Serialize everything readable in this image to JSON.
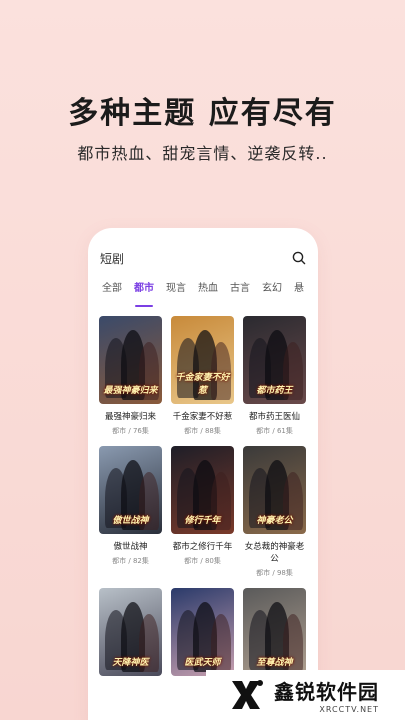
{
  "promo": {
    "title": "多种主题 应有尽有",
    "subtitle": "都市热血、甜宠言情、逆袭反转.."
  },
  "app": {
    "search_text": "短剧",
    "search_icon": "search-icon",
    "accent": "#7b3fe4",
    "tabs": [
      "全部",
      "都市",
      "现言",
      "热血",
      "古言",
      "玄幻",
      "悬"
    ],
    "active_tab": 1,
    "cards": [
      {
        "title": "最强神豪归来",
        "meta": "都市 / 76集",
        "caption": "最强神豪归来",
        "bg1": "#3a4a6a",
        "bg2": "#8a5a3a"
      },
      {
        "title": "千金家妻不好惹",
        "meta": "都市 / 88集",
        "caption": "千金家妻不好惹",
        "bg1": "#c88a3a",
        "bg2": "#e9c78a"
      },
      {
        "title": "都市药王医仙",
        "meta": "都市 / 61集",
        "caption": "都市药王",
        "bg1": "#2a2a30",
        "bg2": "#6a4a4a"
      },
      {
        "title": "傲世战神",
        "meta": "都市 / 82集",
        "caption": "傲世战神",
        "bg1": "#8a9ab0",
        "bg2": "#2a2f3a"
      },
      {
        "title": "都市之修行千年",
        "meta": "都市 / 80集",
        "caption": "修行千年",
        "bg1": "#1e1e28",
        "bg2": "#7a3a2a"
      },
      {
        "title": "女总裁的神豪老公",
        "meta": "都市 / 98集",
        "caption": "神豪老公",
        "bg1": "#3a3a3a",
        "bg2": "#8a6a4a"
      },
      {
        "title": "",
        "meta": "",
        "caption": "天降神医",
        "bg1": "#b8c0c8",
        "bg2": "#4a4a5a"
      },
      {
        "title": "",
        "meta": "",
        "caption": "医武天师",
        "bg1": "#2a3a6a",
        "bg2": "#c8a0b0"
      },
      {
        "title": "",
        "meta": "",
        "caption": "至尊战神",
        "bg1": "#5a5a5a",
        "bg2": "#b0a090"
      }
    ]
  },
  "watermark": {
    "name": "鑫锐软件园",
    "url": "XRCCTV.NET"
  }
}
